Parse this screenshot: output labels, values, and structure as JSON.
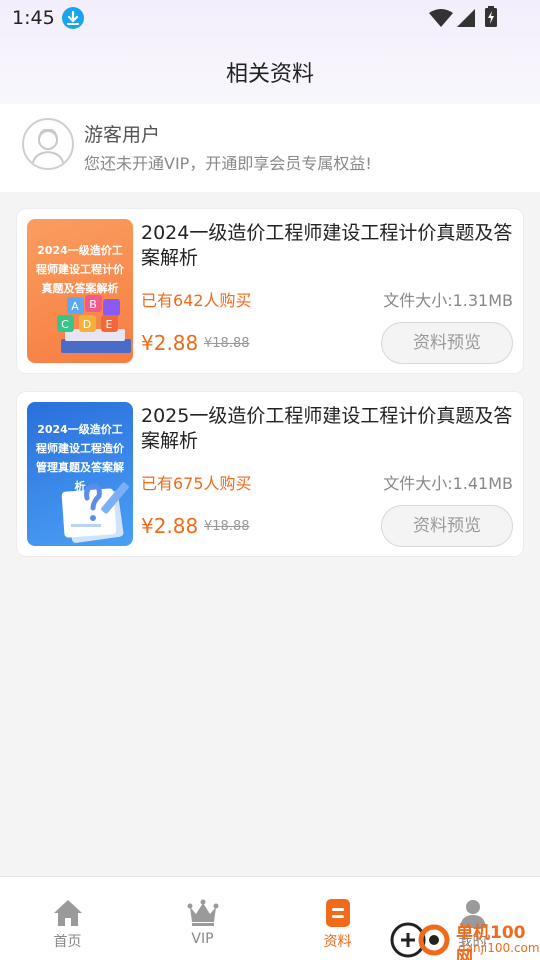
{
  "status_bar": {
    "time": "1:45",
    "icons": [
      "download-icon",
      "wifi-icon",
      "cellular-icon",
      "battery-icon"
    ]
  },
  "header": {
    "title": "相关资料"
  },
  "user": {
    "name": "游客用户",
    "description": "您还未开通VIP，开通即享会员专属权益!"
  },
  "items": [
    {
      "title": "2024一级造价工程师建设工程计价真题及答案解析",
      "cover_text": "2024一级造价工程师建设工程计价真题及答案解析",
      "cover_letters": [
        "A",
        "B",
        "C",
        "D",
        "E"
      ],
      "buyers": "已有642人购买",
      "file_size": "文件大小:1.31MB",
      "price": "¥2.88",
      "original_price": "¥18.88",
      "button": "资料预览"
    },
    {
      "title": "2025一级造价工程师建设工程计价真题及答案解析",
      "cover_text": "2024一级造价工程师建设工程造价管理真题及答案解析",
      "buyers": "已有675人购买",
      "file_size": "文件大小:1.41MB",
      "price": "¥2.88",
      "original_price": "¥18.88",
      "button": "资料预览"
    }
  ],
  "tabs": [
    {
      "label": "首页",
      "icon": "home-icon",
      "active": false
    },
    {
      "label": "VIP",
      "icon": "crown-icon",
      "active": false
    },
    {
      "label": "资料",
      "icon": "document-icon",
      "active": true
    },
    {
      "label": "我的",
      "icon": "person-icon",
      "active": false
    }
  ],
  "watermark": {
    "line1": "单机100网",
    "line2": "danji100.com"
  },
  "colors": {
    "accent": "#f06a1a",
    "download_badge": "#1aa4f0",
    "cover1": "#f98b4b",
    "cover2": "#2f7be0"
  }
}
